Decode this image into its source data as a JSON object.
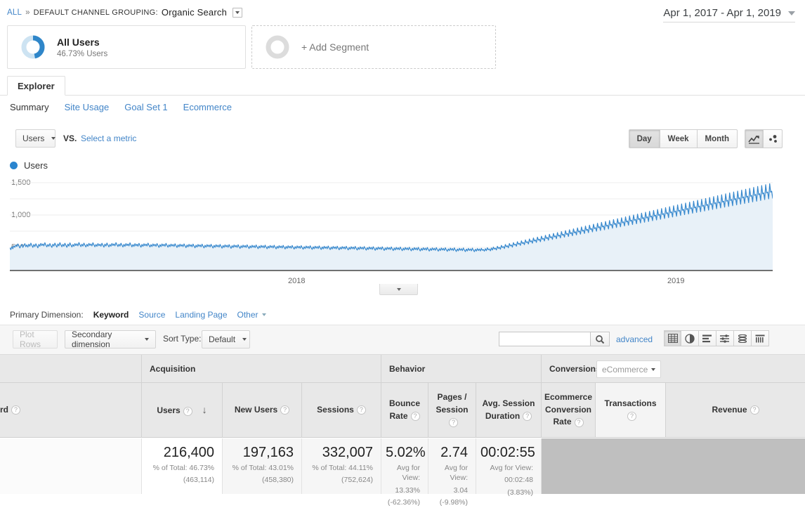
{
  "breadcrumb": {
    "all": "ALL",
    "separator": "»",
    "dimension_label": "DEFAULT CHANNEL GROUPING:",
    "dimension_value": "Organic Search"
  },
  "date_range": {
    "value": "Apr 1, 2017 - Apr 1, 2019"
  },
  "segments": [
    {
      "title": "All Users",
      "subtitle": "46.73% Users",
      "percent": 46.73
    },
    {
      "title": "+ Add Segment"
    }
  ],
  "tabs": {
    "explorer": "Explorer"
  },
  "subtabs": [
    {
      "label": "Summary",
      "active": true
    },
    {
      "label": "Site Usage",
      "active": false
    },
    {
      "label": "Goal Set 1",
      "active": false
    },
    {
      "label": "Ecommerce",
      "active": false
    }
  ],
  "metric_bar": {
    "metric": "Users",
    "vs": "VS.",
    "select_metric": "Select a metric",
    "granularity": [
      {
        "label": "Day",
        "selected": true
      },
      {
        "label": "Week",
        "selected": false
      },
      {
        "label": "Month",
        "selected": false
      }
    ],
    "chart_types": [
      {
        "name": "line-chart-icon",
        "selected": true
      },
      {
        "name": "motion-chart-icon",
        "selected": false
      }
    ]
  },
  "chart_data": {
    "type": "line",
    "title": "Users",
    "xlabel": "",
    "ylabel": "Users",
    "ylim": [
      0,
      1750
    ],
    "yticks": [
      500,
      1000,
      1500
    ],
    "ytick_labels": [
      "500",
      "1,000",
      "1,500"
    ],
    "xticks": [
      "2018",
      "2019"
    ],
    "grid": true,
    "legend": [
      "Users"
    ],
    "series_color": "#3a8ace",
    "fill_color": "#e6f0f8",
    "series": [
      {
        "name": "Users",
        "values": [
          430,
          398,
          452,
          415,
          470,
          442,
          486,
          455,
          505,
          468,
          430,
          462,
          498,
          440,
          475,
          510,
          452,
          488,
          445,
          500,
          462,
          520,
          478,
          440,
          495,
          455,
          508,
          470,
          432,
          498,
          462,
          515,
          475,
          505,
          468,
          528,
          482,
          450,
          495,
          460,
          512,
          472,
          440,
          500,
          465,
          520,
          480,
          445,
          505,
          468,
          530,
          488,
          452,
          498,
          462,
          518,
          478,
          442,
          502,
          465,
          525,
          485,
          448,
          495,
          460,
          512,
          475,
          508,
          470,
          532,
          490,
          455,
          500,
          465,
          520,
          482,
          448,
          498,
          462,
          515,
          478,
          505,
          468,
          528,
          488,
          452,
          495,
          460,
          512,
          472,
          500,
          462,
          518,
          480,
          445,
          502,
          466,
          522,
          484,
          450,
          496,
          462,
          514,
          476,
          506,
          470,
          530,
          492,
          456,
          500,
          464,
          518,
          482,
          448,
          498,
          460,
          512,
          474,
          504,
          468,
          526,
          488,
          450,
          494,
          458,
          510,
          470,
          500,
          462,
          516,
          478,
          444,
          496,
          460,
          508,
          472,
          502,
          466,
          520,
          482,
          448,
          492,
          456,
          505,
          468,
          498,
          460,
          512,
          476,
          440,
          492,
          455,
          505,
          468,
          498,
          462,
          516,
          478,
          444,
          490,
          454,
          502,
          465,
          495,
          458,
          508,
          472,
          438,
          488,
          452,
          500,
          462,
          492,
          455,
          505,
          468,
          435,
          485,
          450,
          498,
          460,
          490,
          452,
          502,
          465,
          432,
          482,
          446,
          495,
          458,
          488,
          450,
          500,
          462,
          430,
          480,
          444,
          492,
          455,
          485,
          448,
          498,
          460,
          428,
          478,
          442,
          490,
          452,
          482,
          445,
          495,
          458,
          425,
          475,
          440,
          488,
          450,
          480,
          442,
          492,
          455,
          422,
          472,
          438,
          485,
          448,
          478,
          440,
          490,
          452,
          420,
          470,
          435,
          482,
          445,
          475,
          438,
          488,
          450,
          418,
          468,
          432,
          480,
          442,
          472,
          435,
          485,
          448,
          416,
          465,
          430,
          478,
          440,
          470,
          432,
          482,
          445,
          414,
          462,
          428,
          475,
          438,
          468,
          430,
          480,
          442,
          412,
          460,
          425,
          472,
          435,
          465,
          428,
          478,
          440,
          410,
          458,
          422,
          470,
          432,
          462,
          425,
          475,
          438,
          408,
          455,
          420,
          468,
          430,
          460,
          422,
          472,
          435,
          405,
          452,
          418,
          465,
          428,
          458,
          420,
          470,
          432,
          402,
          450,
          415,
          462,
          425,
          455,
          418,
          468,
          430,
          400,
          448,
          412,
          460,
          422,
          452,
          415,
          465,
          428,
          398,
          445,
          410,
          458,
          420,
          450,
          412,
          462,
          425,
          395,
          442,
          408,
          455,
          418,
          448,
          410,
          460,
          422,
          392,
          440,
          405,
          452,
          415,
          445,
          408,
          458,
          420,
          390,
          438,
          402,
          450,
          412,
          442,
          405,
          455,
          418,
          388,
          435,
          400,
          448,
          410,
          440,
          402,
          452,
          415,
          385,
          432,
          398,
          445,
          408,
          438,
          400,
          450,
          412,
          382,
          430,
          395,
          442,
          405,
          435,
          398,
          448,
          410,
          380,
          428,
          392,
          440,
          402,
          432,
          395,
          445,
          408,
          378,
          425,
          390,
          438,
          400,
          430,
          392,
          442,
          405,
          375,
          422,
          388,
          435,
          398,
          428,
          390,
          440,
          402,
          372,
          420,
          385,
          432,
          395,
          425,
          388,
          438,
          400,
          370,
          418,
          382,
          430,
          392,
          422,
          385,
          435,
          398,
          368,
          415,
          380,
          428,
          390,
          420,
          382,
          432,
          395,
          365,
          412,
          378,
          425,
          388,
          418,
          380,
          430,
          392,
          362,
          410,
          375,
          422,
          385,
          415,
          378,
          428,
          390,
          360,
          408,
          372,
          420,
          382,
          412,
          375,
          425,
          388,
          358,
          405,
          370,
          418,
          380,
          410,
          372,
          422,
          385,
          400,
          368,
          415,
          378,
          432,
          395,
          410,
          375,
          428,
          390,
          445,
          408,
          425,
          392,
          460,
          420,
          440,
          405,
          478,
          438,
          455,
          418,
          495,
          452,
          470,
          432,
          512,
          468,
          485,
          445,
          530,
          485,
          500,
          462,
          548,
          500,
          518,
          478,
          565,
          515,
          532,
          492,
          582,
          532,
          548,
          505,
          600,
          548,
          565,
          520,
          618,
          562,
          580,
          535,
          635,
          578,
          595,
          548,
          652,
          595,
          612,
          562,
          670,
          610,
          628,
          578,
          688,
          625,
          642,
          592,
          705,
          640,
          658,
          605,
          722,
          655,
          672,
          620,
          740,
          672,
          688,
          635,
          758,
          688,
          705,
          648,
          775,
          702,
          720,
          662,
          792,
          718,
          735,
          678,
          810,
          735,
          752,
          692,
          828,
          750,
          768,
          705,
          845,
          765,
          782,
          720,
          862,
          782,
          798,
          735,
          880,
          798,
          815,
          748,
          898,
          815,
          832,
          762,
          915,
          830,
          848,
          775,
          932,
          845,
          862,
          790,
          950,
          862,
          878,
          805,
          968,
          878,
          895,
          818,
          985,
          892,
          910,
          832,
          1002,
          908,
          925,
          848,
          1020,
          925,
          942,
          862,
          1038,
          940,
          958,
          875,
          1055,
          955,
          972,
          890,
          1072,
          972,
          988,
          905,
          1090,
          988,
          1005,
          918,
          1108,
          1002,
          1020,
          932,
          1125,
          1018,
          1035,
          948,
          1142,
          1035,
          1052,
          962,
          1160,
          1050,
          1068,
          975,
          1178,
          1065,
          1082,
          990,
          1195,
          1082,
          1098,
          1005,
          1212,
          1098,
          1115,
          1018,
          1230,
          1112,
          1130,
          1032,
          1248,
          1128,
          1145,
          1048,
          1265,
          1145,
          1162,
          1062,
          1282,
          1160,
          1178,
          1075,
          1300,
          1175,
          1192,
          1090,
          1318,
          1192,
          1208,
          1105,
          1335,
          1208,
          1225,
          1118,
          1352,
          1222,
          1240,
          1132,
          1370,
          1238,
          1255,
          1148,
          1388,
          1255,
          1272,
          1162,
          1405,
          1270,
          1288,
          1175,
          1422,
          1285,
          1302,
          1190,
          1440,
          1302,
          1318,
          1205,
          1458,
          1318,
          1335,
          1218,
          1475,
          1332,
          1350,
          1232,
          1492,
          1348,
          1365,
          1248,
          1510,
          1365,
          1382,
          1262,
          1528,
          1380,
          1398,
          1275,
          1545,
          1395,
          1412,
          1290,
          1562,
          1412,
          1428,
          1305,
          1580,
          1428,
          1445,
          1318,
          1598,
          1442,
          1460,
          1332,
          1615,
          1458,
          1475,
          1348,
          1632,
          1475,
          1492,
          1362,
          1650,
          1490,
          1508,
          1375
        ]
      }
    ]
  },
  "primary_dimension": {
    "label": "Primary Dimension:",
    "items": [
      {
        "label": "Keyword",
        "active": true
      },
      {
        "label": "Source",
        "active": false
      },
      {
        "label": "Landing Page",
        "active": false
      }
    ],
    "other": "Other"
  },
  "table_toolbar": {
    "plot_rows": "Plot Rows",
    "secondary_dimension": "Secondary dimension",
    "sort_type_label": "Sort Type:",
    "sort_type_value": "Default",
    "search_value": "",
    "search_placeholder": "",
    "advanced": "advanced",
    "view_icons": [
      {
        "name": "table-view-icon",
        "selected": true
      },
      {
        "name": "pie-view-icon",
        "selected": false
      },
      {
        "name": "performance-view-icon",
        "selected": false
      },
      {
        "name": "comparison-view-icon",
        "selected": false
      },
      {
        "name": "pivot-view-icon",
        "selected": false
      },
      {
        "name": "term-cloud-view-icon",
        "selected": false
      }
    ]
  },
  "table": {
    "dimension_header": "rd",
    "groups": [
      {
        "label": "Acquisition"
      },
      {
        "label": "Behavior"
      },
      {
        "label": "Conversions"
      }
    ],
    "conversions_select": "eCommerce",
    "columns": [
      {
        "label": "Users",
        "sorted": true,
        "sort_dir": "↓"
      },
      {
        "label": "New Users"
      },
      {
        "label": "Sessions"
      },
      {
        "label": "Bounce Rate"
      },
      {
        "label": "Pages / Session"
      },
      {
        "label": "Avg. Session Duration"
      },
      {
        "label": "Ecommerce Conversion Rate"
      },
      {
        "label": "Transactions"
      },
      {
        "label": "Revenue"
      }
    ],
    "summary_row": [
      {
        "value": "216,400",
        "sub1": "% of Total: 46.73%",
        "sub2": "(463,114)"
      },
      {
        "value": "197,163",
        "sub1": "% of Total: 43.01%",
        "sub2": "(458,380)"
      },
      {
        "value": "332,007",
        "sub1": "% of Total: 44.11%",
        "sub2": "(752,624)"
      },
      {
        "value": "5.02%",
        "sub1": "Avg for View:",
        "sub2": "13.33%",
        "sub3": "(-62.36%)"
      },
      {
        "value": "2.74",
        "sub1": "Avg for View:",
        "sub2": "3.04",
        "sub3": "(-9.98%)"
      },
      {
        "value": "00:02:55",
        "sub1": "Avg for View:",
        "sub2": "00:02:48",
        "sub3": "(3.83%)"
      }
    ]
  }
}
